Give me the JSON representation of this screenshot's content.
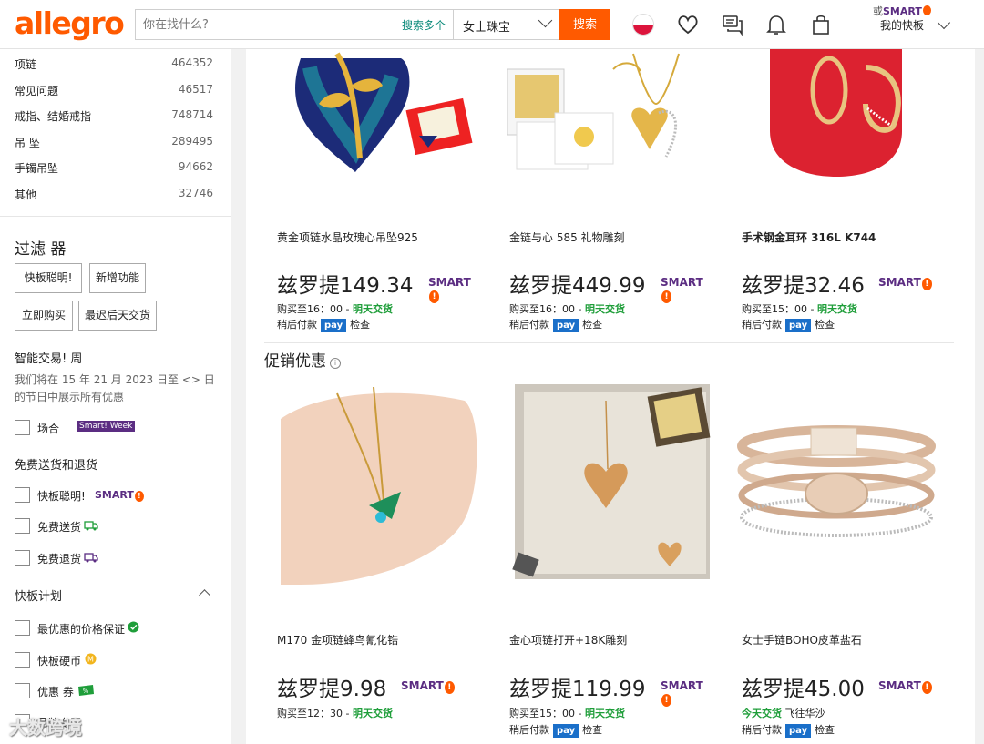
{
  "header": {
    "logo": "allegro",
    "search_placeholder": "你在找什么?",
    "search_multi": "搜索多个",
    "category": "女士珠宝",
    "search_button": "搜索",
    "smart_or": "或",
    "smart_label": "SMART",
    "account_label": "我的快板"
  },
  "sidebar": {
    "categories": [
      {
        "name": "项链",
        "count": "464352"
      },
      {
        "name": "常见问题",
        "count": "46517"
      },
      {
        "name": "戒指、结婚戒指",
        "count": "748714"
      },
      {
        "name": "吊 坠",
        "count": "289495"
      },
      {
        "name": "手镯吊坠",
        "count": "94662"
      },
      {
        "name": "其他",
        "count": "32746"
      }
    ],
    "filters_title": "过滤 器",
    "chips": [
      "快板聪明!",
      "新增功能",
      "立即购买",
      "最迟后天交货"
    ],
    "smart_week_title": "智能交易! 周",
    "smart_week_desc": "我们将在 15 年 21 月 2023 日至 <> 日的节日中展示所有优惠",
    "occasion_label": "场合",
    "smart_week_tag": "Smart! Week",
    "shipping_title": "免费送货和退货",
    "shipping_options": [
      "快板聪明!",
      "免费送货",
      "免费退货"
    ],
    "plan_title": "快板计划",
    "plan_options": [
      "最优惠的价格保证",
      "快板硬币",
      "优惠 券",
      "品牌专区"
    ],
    "smart_badge": "SMART"
  },
  "products_top": [
    {
      "title": "黄金项链水晶玫瑰心吊坠925",
      "price": "兹罗提149.34",
      "ship_prefix": "购买至16：00 - ",
      "ship_day": "明天交货",
      "pay_later": "稍后付款",
      "pay": "pay",
      "check": "检查"
    },
    {
      "title": "金链与心 585 礼物雕刻",
      "price": "兹罗提449.99",
      "ship_prefix": "购买至16：00 - ",
      "ship_day": "明天交货",
      "pay_later": "稍后付款",
      "pay": "pay",
      "check": "检查"
    },
    {
      "title": "手术钢金耳环 316L K744",
      "price": "兹罗提32.46",
      "ship_prefix": "购买至15：00 - ",
      "ship_day": "明天交货",
      "pay_later": "稍后付款",
      "pay": "pay",
      "check": "检查"
    }
  ],
  "promo_title": "促销优惠",
  "products_bottom": [
    {
      "title": "M170 金项链蜂鸟氰化锆",
      "price": "兹罗提9.98",
      "ship_prefix": "购买至12：30 - ",
      "ship_day": "明天交货"
    },
    {
      "title": "金心项链打开+18K雕刻",
      "price": "兹罗提119.99",
      "ship_prefix": "购买至15：00 - ",
      "ship_day": "明天交货",
      "pay_later": "稍后付款",
      "pay": "pay",
      "check": "检查"
    },
    {
      "title": "女士手链BOHO皮革盐石",
      "price": "兹罗提45.00",
      "ship_day": "今天交货",
      "ship_suffix": "飞往华沙",
      "pay_later": "稍后付款",
      "pay": "pay",
      "check": "检查"
    }
  ],
  "product_smart": "SMART",
  "watermark": "大数跨境",
  "colors": {
    "accent": "#ff5a00",
    "smart": "#5b2d82",
    "delivery": "#1f9e3a",
    "pay": "#1a6fc9"
  }
}
